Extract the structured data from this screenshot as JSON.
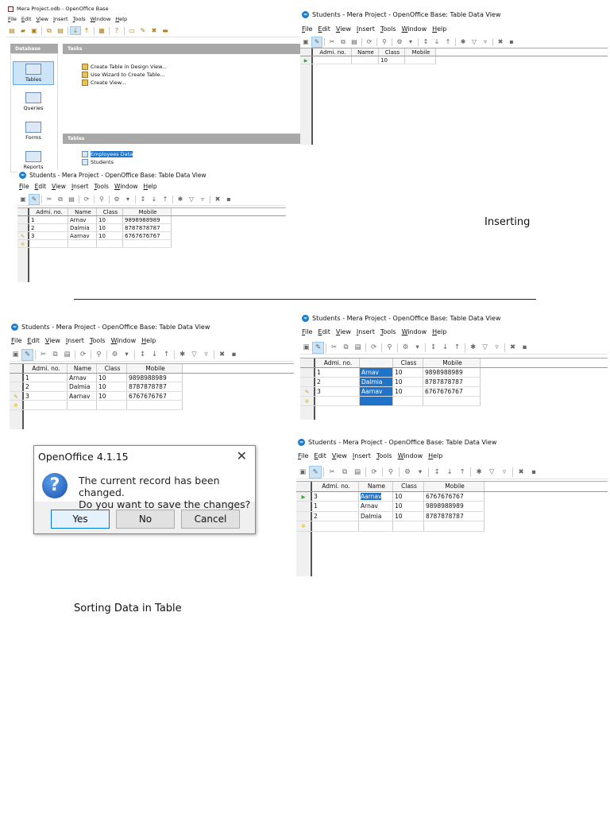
{
  "menu": [
    "File",
    "Edit",
    "View",
    "Insert",
    "Tools",
    "Window",
    "Help"
  ],
  "base_window": {
    "title": "Mera Project.odb - OpenOffice Base",
    "database_header": "Database",
    "sidebar": [
      "Tables",
      "Queries",
      "Forms",
      "Reports"
    ],
    "selected_sidebar": "Tables",
    "tasks_header": "Tasks",
    "tasks": [
      "Create Table in Design View...",
      "Use Wizard to Create Table...",
      "Create View..."
    ],
    "tables_header": "Tables",
    "tables": [
      "Employees Data",
      "Students"
    ],
    "selected_table": "Employees Data"
  },
  "views": [
    {
      "title": "Students - Mera Project - OpenOffice Base: Table Data View",
      "columns": [
        "Admi. no.",
        "Name",
        "Class",
        "Mobile"
      ],
      "rows": [
        [
          "",
          "",
          "10",
          ""
        ]
      ],
      "markers": [
        "current-arrow"
      ]
    },
    {
      "title": "Students - Mera Project - OpenOffice Base: Table Data View",
      "columns": [
        "Admi. no.",
        "Name",
        "Class",
        "Mobile"
      ],
      "rows": [
        [
          "1",
          "Arnav",
          "10",
          "9898988989"
        ],
        [
          "2",
          "Dalmia",
          "10",
          "8787878787"
        ],
        [
          "3",
          "Aarnav",
          "10",
          "6767676767"
        ],
        [
          "",
          "",
          "",
          ""
        ]
      ],
      "markers": [
        "",
        "",
        "edit-pencil",
        "new-star"
      ]
    },
    {
      "title": "Students - Mera Project - OpenOffice Base: Table Data View",
      "columns": [
        "Admi. no.",
        "Name",
        "Class",
        "Mobile"
      ],
      "rows": [
        [
          "1",
          "Arnav",
          "10",
          "9898988989"
        ],
        [
          "2",
          "Dalmia",
          "10",
          "8787878787"
        ],
        [
          "3",
          "Aarnav",
          "10",
          "6767676767"
        ],
        [
          "",
          "",
          "",
          ""
        ]
      ],
      "markers": [
        "",
        "",
        "edit-pencil",
        "new-star"
      ]
    },
    {
      "title": "Students - Mera Project - OpenOffice Base: Table Data View",
      "columns": [
        "Admi. no.",
        "Name",
        "Class",
        "Mobile"
      ],
      "rows": [
        [
          "1",
          "Arnav",
          "10",
          "9898988989"
        ],
        [
          "2",
          "Dalmia",
          "10",
          "8787878787"
        ],
        [
          "3",
          "Aarnav",
          "10",
          "6767676767"
        ],
        [
          "",
          "",
          "",
          ""
        ]
      ],
      "markers": [
        "",
        "",
        "edit-pencil",
        "new-star"
      ],
      "selected_column": "Name"
    },
    {
      "title": "Students - Mera Project - OpenOffice Base: Table Data View",
      "columns": [
        "Admi. no.",
        "Name",
        "Class",
        "Mobile"
      ],
      "rows": [
        [
          "3",
          "Aarnav",
          "10",
          "6767676767"
        ],
        [
          "1",
          "Arnav",
          "10",
          "9898988989"
        ],
        [
          "2",
          "Dalmia",
          "10",
          "8787878787"
        ],
        [
          "",
          "",
          "",
          ""
        ]
      ],
      "markers": [
        "current-arrow",
        "",
        "",
        "new-star"
      ],
      "selected_cell": "Aarnav"
    }
  ],
  "dialog": {
    "title": "OpenOffice 4.1.15",
    "message_line1": "The current record has been changed.",
    "message_line2": "Do you want to save the changes?",
    "yes": "Yes",
    "no": "No",
    "cancel": "Cancel"
  },
  "captions": {
    "inserting": "Inserting",
    "sorting": "Sorting Data in Table"
  }
}
